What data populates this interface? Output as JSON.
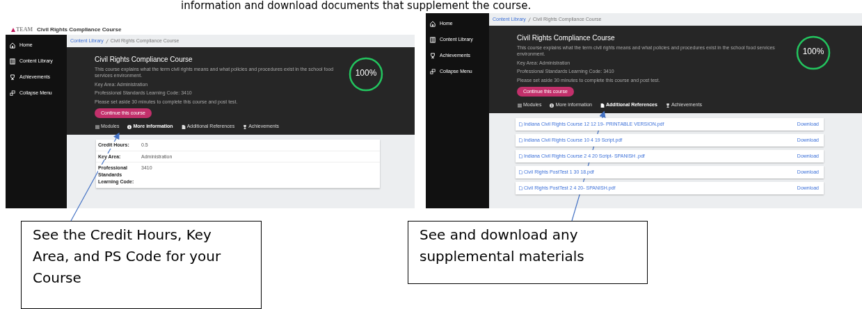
{
  "heading": "information and download documents that supplement the course.",
  "screenshots": [
    {
      "kind": "details",
      "header": {
        "logo": "TEAM",
        "title": "Civil Rights Compliance Course"
      },
      "sidebar": [
        {
          "label": "Home"
        },
        {
          "label": "Content Library"
        },
        {
          "label": "Achievements"
        },
        {
          "label": "Collapse Menu"
        }
      ],
      "breadcrumb": [
        "Content Library",
        "Civil Rights Compliance Course"
      ],
      "course": {
        "title": "Civil Rights Compliance Course",
        "description": "This course explains what the term civil rights means and what policies and procedures exist in the school food services environment.",
        "key_area": "Key Area: Administration",
        "code": "Professional Standards Learning Code: 3410",
        "time_note": "Please set aside 30 minutes to complete this course and post test.",
        "button": "Continue this course",
        "progress": "100%",
        "level": 1
      },
      "tabs": [
        {
          "label": "Modules",
          "selected": false
        },
        {
          "label": "More information",
          "selected": true
        },
        {
          "label": "Additional References",
          "selected": false
        },
        {
          "label": "Achievements",
          "selected": false
        }
      ],
      "details": [
        {
          "label": "Credit Hours:",
          "value": "0.5"
        },
        {
          "label": "Key Area:",
          "value": "Administration"
        },
        {
          "label": "Professional Standards Learning Code:",
          "value": "3410"
        }
      ]
    },
    {
      "kind": "references",
      "sidebar": [
        {
          "label": "Home"
        },
        {
          "label": "Content Library"
        },
        {
          "label": "Achievements"
        },
        {
          "label": "Collapse Menu"
        }
      ],
      "breadcrumb": [
        "Content Library",
        "Civil Rights Compliance Course"
      ],
      "course": {
        "title": "Civil Rights Compliance Course",
        "description": "This course explains what the term civil rights means and what policies and procedures exist in the school food services environment.",
        "key_area": "Key Area: Administration",
        "code": "Professional Standards Learning Code: 3410",
        "time_note": "Please set aside 30 minutes to complete this course and post test.",
        "button": "Continue this course",
        "progress": "100%",
        "level": 1
      },
      "tabs": [
        {
          "label": "Modules",
          "selected": false
        },
        {
          "label": "More information",
          "selected": false
        },
        {
          "label": "Additional References",
          "selected": true
        },
        {
          "label": "Achievements",
          "selected": false
        }
      ],
      "references": [
        {
          "file": "Indiana Civil Rights Course 12 12 19- PRINTABLE VERSION.pdf",
          "action": "Download"
        },
        {
          "file": "Indiana Civil Rights Course 10 4 19 Script.pdf",
          "action": "Download"
        },
        {
          "file": "Indiana Civil Rights Course 2 4 20 Script- SPANISH .pdf",
          "action": "Download"
        },
        {
          "file": "Civil Rights PostTest 1 30 18.pdf",
          "action": "Download"
        },
        {
          "file": "Civil Rights PostTest 2 4 20- SPANISH.pdf",
          "action": "Download"
        }
      ]
    }
  ],
  "callouts": [
    {
      "text": "See the Credit Hours, Key Area, and PS Code for your Course"
    },
    {
      "text": "See and download any supplemental materials"
    }
  ]
}
